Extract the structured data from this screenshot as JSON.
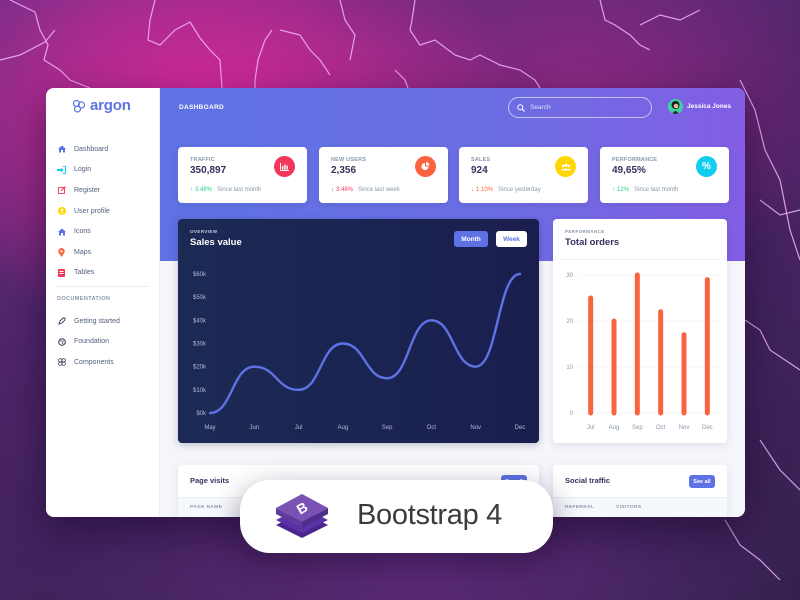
{
  "brand": {
    "name": "argon",
    "accent": "#5e72e4"
  },
  "sidebar": {
    "items": [
      {
        "label": "Dashboard",
        "icon": "home-icon",
        "color": "#5e72e4"
      },
      {
        "label": "Login",
        "icon": "login-icon",
        "color": "#11cdef"
      },
      {
        "label": "Register",
        "icon": "edit-icon",
        "color": "#f5365c"
      },
      {
        "label": "User profile",
        "icon": "user-icon",
        "color": "#ffd600"
      },
      {
        "label": "Icons",
        "icon": "home-icon",
        "color": "#5e72e4"
      },
      {
        "label": "Maps",
        "icon": "map-pin-icon",
        "color": "#fb6340"
      },
      {
        "label": "Tables",
        "icon": "table-icon",
        "color": "#f5365c"
      }
    ],
    "doc_heading": "DOCUMENTATION",
    "doc_items": [
      {
        "label": "Getting started",
        "icon": "rocket-icon"
      },
      {
        "label": "Foundation",
        "icon": "palette-icon"
      },
      {
        "label": "Components",
        "icon": "components-icon"
      }
    ]
  },
  "topbar": {
    "title": "DASHBOARD",
    "search_placeholder": "Search",
    "user_name": "Jessica Jones"
  },
  "stats": [
    {
      "title": "TRAFFIC",
      "value": "350,897",
      "icon": "bar-chart-icon",
      "icon_color": "#f5365c",
      "direction": "up",
      "change": "3.48%",
      "change_color": "#2dce89",
      "since": "Since last month"
    },
    {
      "title": "NEW USERS",
      "value": "2,356",
      "icon": "pie-chart-icon",
      "icon_color": "#fb6340",
      "direction": "down",
      "change": "3.48%",
      "change_color": "#f5365c",
      "since": "Since last week"
    },
    {
      "title": "SALES",
      "value": "924",
      "icon": "users-icon",
      "icon_color": "#ffd600",
      "direction": "down",
      "change": "1.10%",
      "change_color": "#fb6340",
      "since": "Since yesterday"
    },
    {
      "title": "PERFORMANCE",
      "value": "49,65%",
      "icon": "percent-icon",
      "icon_color": "#11cdef",
      "direction": "up",
      "change": "12%",
      "change_color": "#2dce89",
      "since": "Since last month"
    }
  ],
  "overview": {
    "kicker": "OVERVIEW",
    "title": "Sales value",
    "buttons": {
      "month": "Month",
      "week": "Week"
    }
  },
  "performance": {
    "kicker": "PERFORMANCE",
    "title": "Total orders"
  },
  "page_visits": {
    "title": "Page visits",
    "button": "See all",
    "columns": [
      "PAGE NAME"
    ]
  },
  "social_traffic": {
    "title": "Social traffic",
    "button": "See all",
    "columns": [
      "REFERRAL",
      "VISITORS"
    ]
  },
  "badge": {
    "text": "Bootstrap 4",
    "logo_letter": "B"
  },
  "chart_data": [
    {
      "type": "line",
      "title": "Sales value",
      "categories": [
        "May",
        "Jun",
        "Jul",
        "Aug",
        "Sep",
        "Oct",
        "Nov",
        "Dec"
      ],
      "series": [
        {
          "name": "Sales",
          "values": [
            0,
            20,
            10,
            30,
            15,
            40,
            20,
            60
          ]
        }
      ],
      "yticks": [
        "$0k",
        "$10k",
        "$20k",
        "$30k",
        "$40k",
        "$50k",
        "$60k"
      ],
      "ylim": [
        0,
        60
      ],
      "grid": false,
      "color": "#5e72e4"
    },
    {
      "type": "bar",
      "title": "Total orders",
      "categories": [
        "Jul",
        "Aug",
        "Sep",
        "Oct",
        "Nov",
        "Dec"
      ],
      "values": [
        25,
        20,
        30,
        22,
        17,
        29
      ],
      "yticks": [
        "0",
        "10",
        "20",
        "30"
      ],
      "ylim": [
        0,
        30
      ],
      "grid": true,
      "color": "#fb6340"
    }
  ]
}
